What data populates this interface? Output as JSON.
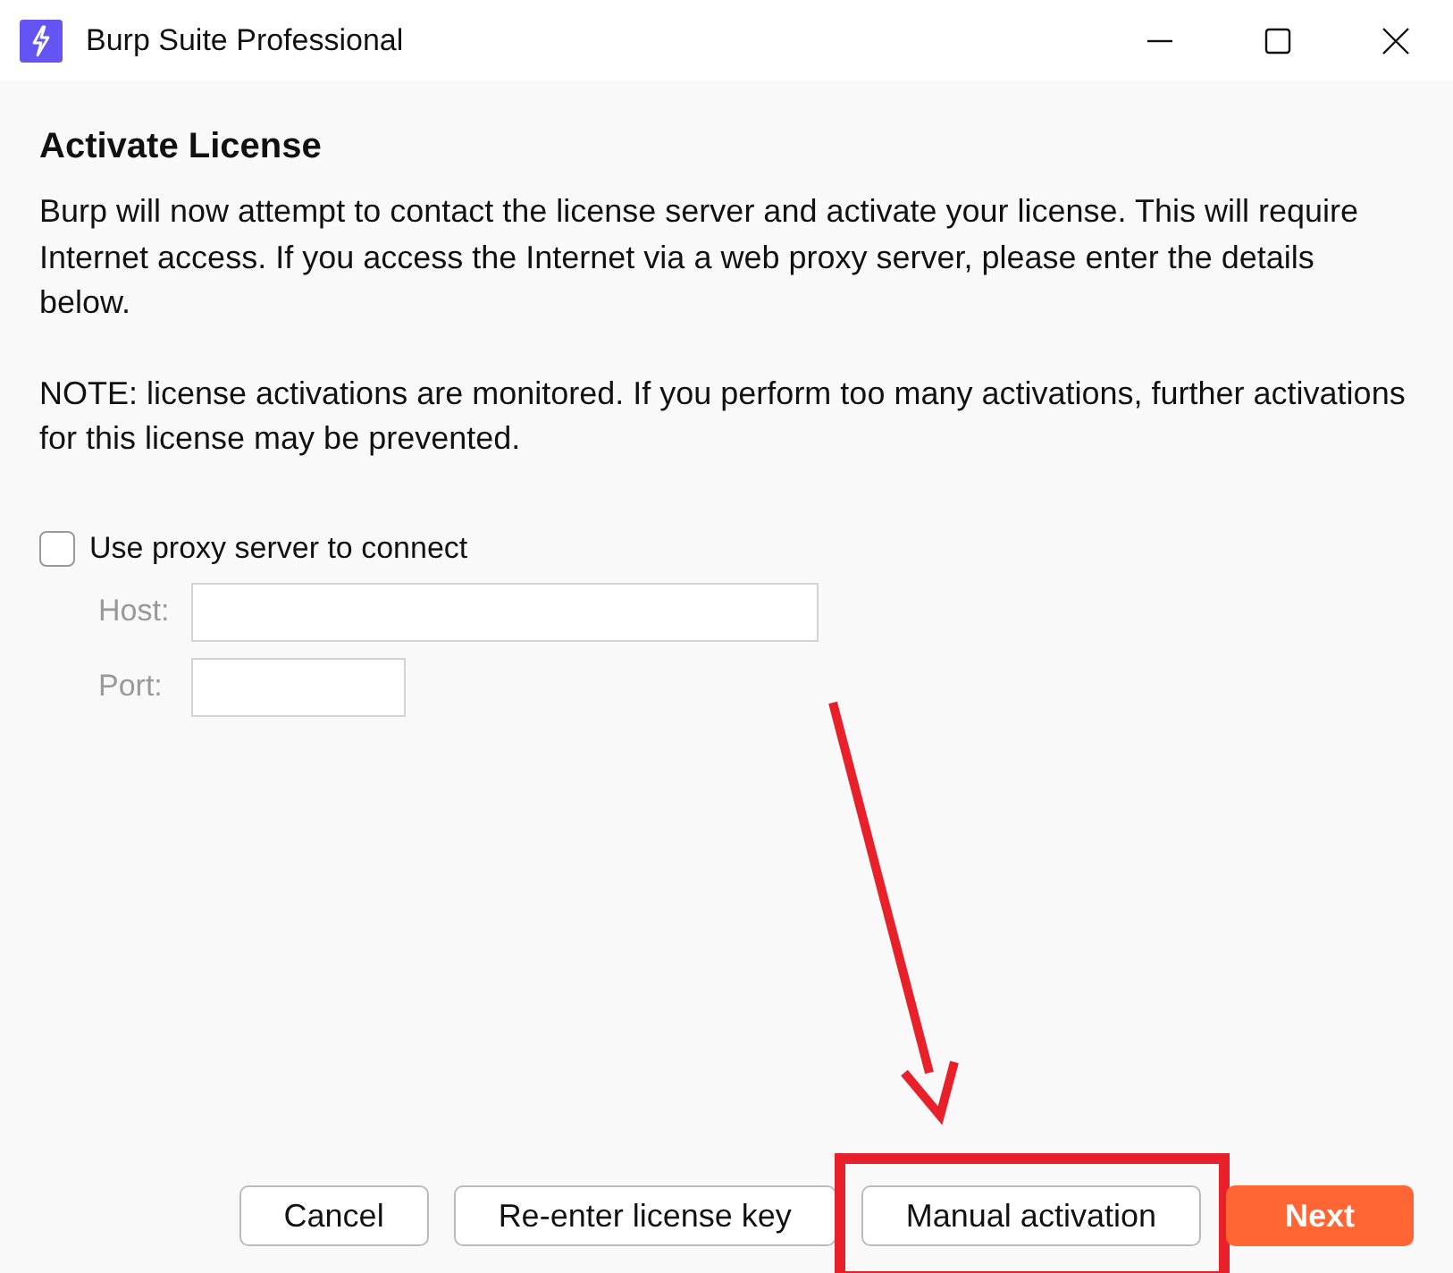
{
  "window": {
    "title": "Burp Suite Professional"
  },
  "heading": "Activate License",
  "paragraphs": [
    "Burp will now attempt to contact the license server and activate your license. This will require Internet access. If you access the Internet via a web proxy server, please enter the details below.",
    "NOTE: license activations are monitored. If you perform too many activations, further activations for this license may be prevented."
  ],
  "proxy": {
    "label": "Use proxy server to connect",
    "checked": false,
    "fields": [
      {
        "label": "Host:",
        "kind": "wide",
        "disabled": true
      },
      {
        "label": "Port:",
        "kind": "narrow",
        "disabled": true
      }
    ]
  },
  "buttons": [
    {
      "label": "Cancel",
      "kind": "default",
      "highlighted": false
    },
    {
      "label": "Re-enter license key",
      "kind": "default",
      "highlighted": false
    },
    {
      "label": "Manual activation",
      "kind": "default",
      "highlighted": true
    },
    {
      "label": "Next",
      "kind": "primary",
      "highlighted": false
    }
  ]
}
